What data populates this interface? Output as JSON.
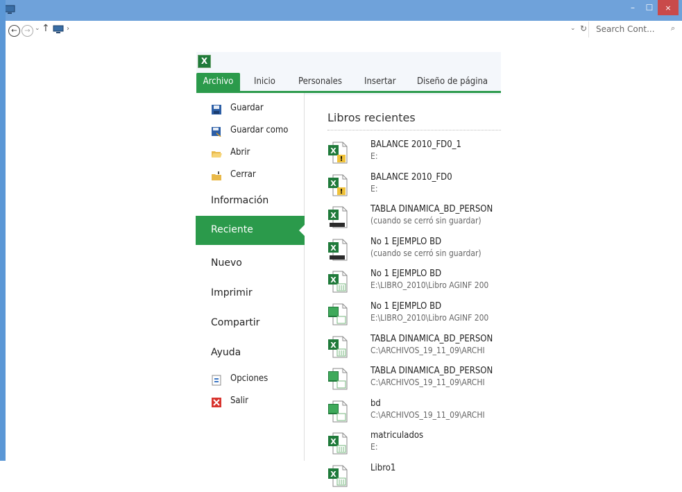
{
  "window": {
    "minimize": "–",
    "maximize": "☐",
    "close": "×"
  },
  "addressbar": {
    "back": "←",
    "forward": "→",
    "dropdown": "⌄",
    "up": "↑",
    "chevron": "›",
    "refresh": "↻",
    "search_placeholder": "Search Cont...",
    "search_icon": "⌕"
  },
  "excel": {
    "logo": "X",
    "tabs": [
      "Archivo",
      "Inicio",
      "Personales",
      "Insertar",
      "Diseño de página"
    ],
    "backstage": {
      "small_items": [
        {
          "label": "Guardar",
          "icon": "save-icon"
        },
        {
          "label": "Guardar como",
          "icon": "save-as-icon"
        },
        {
          "label": "Abrir",
          "icon": "open-folder-icon"
        },
        {
          "label": "Cerrar",
          "icon": "close-folder-icon"
        }
      ],
      "informacion": "Información",
      "reciente": "Reciente",
      "nuevo": "Nuevo",
      "imprimir": "Imprimir",
      "compartir": "Compartir",
      "ayuda": "Ayuda",
      "opciones": "Opciones",
      "salir": "Salir"
    },
    "recent": {
      "title": "Libros recientes",
      "files": [
        {
          "name": "BALANCE 2010_FD0_1",
          "path": "E:",
          "icon": "excel-warning-icon"
        },
        {
          "name": "BALANCE 2010_FD0",
          "path": "E:",
          "icon": "excel-warning-icon"
        },
        {
          "name": "TABLA DINAMICA_BD_PERSON",
          "path": "(cuando se cerró sin guardar)",
          "icon": "excel-unsaved-icon"
        },
        {
          "name": "No 1 EJEMPLO BD",
          "path": "(cuando se cerró sin guardar)",
          "icon": "excel-unsaved-icon"
        },
        {
          "name": "No 1 EJEMPLO BD",
          "path": "E:\\LIBRO_2010\\Libro AGINF 200",
          "icon": "excel-file-icon"
        },
        {
          "name": "No 1 EJEMPLO BD",
          "path": "E:\\LIBRO_2010\\Libro AGINF 200",
          "icon": "excel-compat-icon"
        },
        {
          "name": "TABLA DINAMICA_BD_PERSON",
          "path": "C:\\ARCHIVOS_19_11_09\\ARCHI",
          "icon": "excel-file-icon"
        },
        {
          "name": "TABLA DINAMICA_BD_PERSON",
          "path": "C:\\ARCHIVOS_19_11_09\\ARCHI",
          "icon": "excel-compat-icon"
        },
        {
          "name": "bd",
          "path": "C:\\ARCHIVOS_19_11_09\\ARCHI",
          "icon": "excel-compat-icon"
        },
        {
          "name": "matriculados",
          "path": "E:",
          "icon": "excel-file-icon"
        },
        {
          "name": "Libro1",
          "path": "",
          "icon": "excel-file-icon"
        }
      ]
    }
  }
}
